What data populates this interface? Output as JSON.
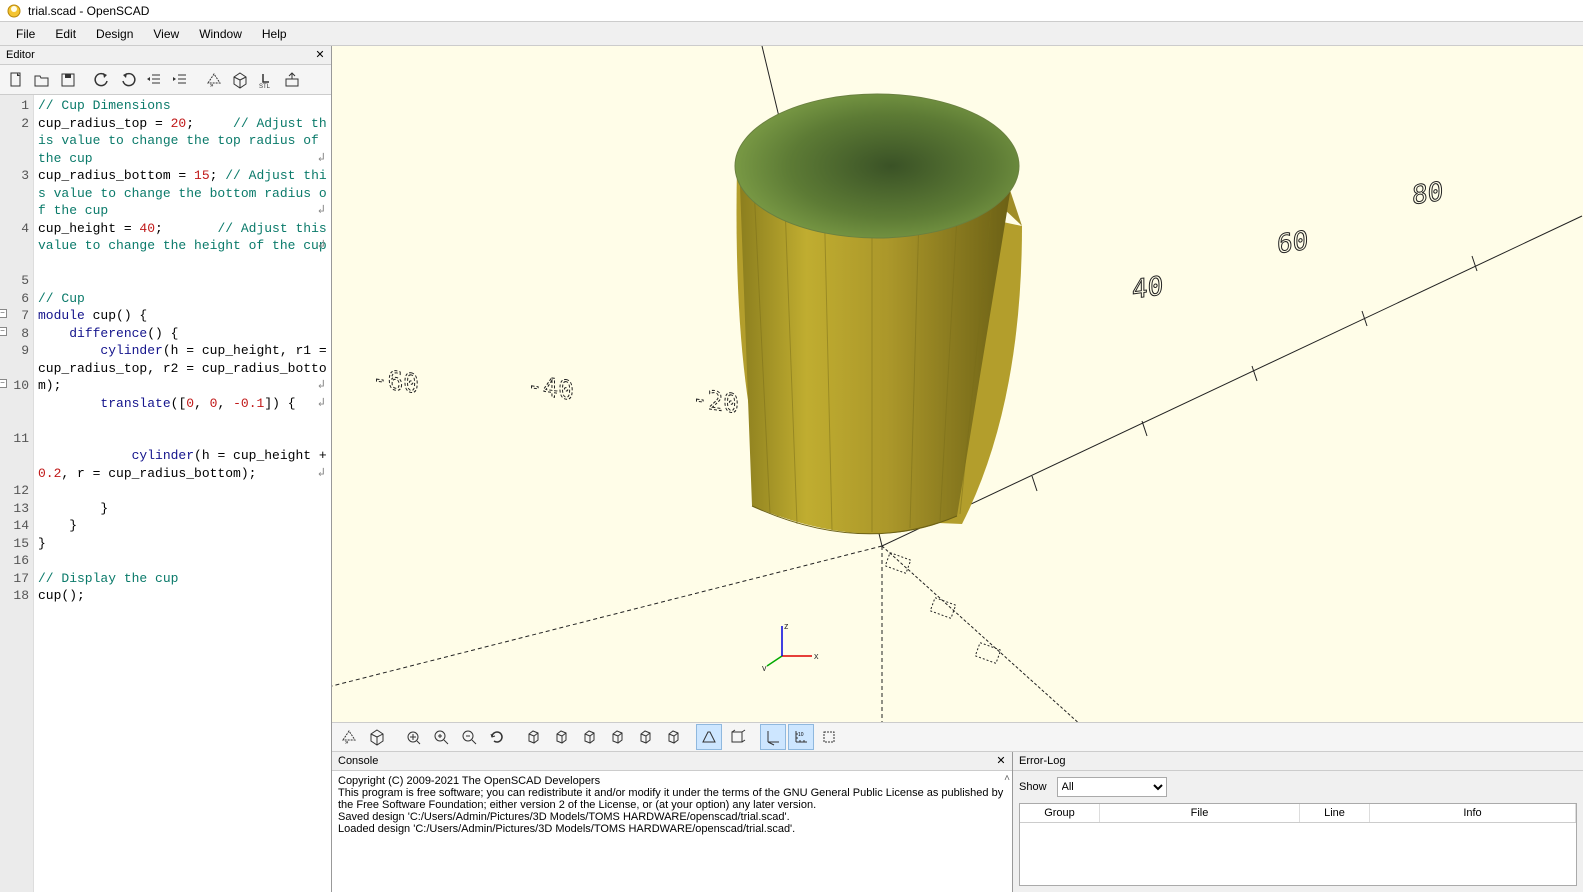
{
  "window": {
    "title": "trial.scad - OpenSCAD"
  },
  "menu": [
    "File",
    "Edit",
    "Design",
    "View",
    "Window",
    "Help"
  ],
  "editor": {
    "panel_title": "Editor",
    "toolbar_icons": [
      "new-icon",
      "open-icon",
      "save-icon",
      "undo-icon",
      "redo-icon",
      "unindent-icon",
      "indent-icon",
      "preview-icon",
      "render-icon",
      "stl-icon",
      "send-icon"
    ],
    "code_lines": [
      {
        "n": 1,
        "wrap": false,
        "html": "<span class='c-comment'>// Cup Dimensions</span>"
      },
      {
        "n": 2,
        "wrap": true,
        "html": "cup_radius_top = <span class='c-num'>20</span>;     <span class='c-comment'>// Adjust this value to change the top radius of the cup</span>"
      },
      {
        "n": 3,
        "wrap": true,
        "html": "cup_radius_bottom = <span class='c-num'>15</span>; <span class='c-comment'>// Adjust this value to change the bottom radius of the cup</span>"
      },
      {
        "n": 4,
        "wrap": true,
        "html": "cup_height = <span class='c-num'>40</span>;       <span class='c-comment'>// Adjust this value to change the height of the cup</span>"
      },
      {
        "n": 5,
        "wrap": false,
        "html": ""
      },
      {
        "n": 6,
        "wrap": false,
        "html": "<span class='c-comment'>// Cup</span>"
      },
      {
        "n": 7,
        "wrap": false,
        "fold": true,
        "html": "<span class='c-keyword'>module</span> cup() {"
      },
      {
        "n": 8,
        "wrap": false,
        "fold": true,
        "html": "    <span class='c-keyword'>difference</span>() {"
      },
      {
        "n": 9,
        "wrap": true,
        "html": "        <span class='c-keyword'>cylinder</span>(h = cup_height, r1 = cup_radius_top, r2 = cup_radius_bottom);"
      },
      {
        "n": 10,
        "wrap": true,
        "fold": true,
        "html": "        <span class='c-keyword'>translate</span>([<span class='c-num'>0</span>, <span class='c-num'>0</span>, <span class='c-num'>-0.1</span>]) {"
      },
      {
        "n": 11,
        "wrap": true,
        "html": "            <span class='c-keyword'>cylinder</span>(h = cup_height + <span class='c-num'>0.2</span>, r = cup_radius_bottom);"
      },
      {
        "n": 12,
        "wrap": false,
        "html": "        }"
      },
      {
        "n": 13,
        "wrap": false,
        "html": "    }"
      },
      {
        "n": 14,
        "wrap": false,
        "html": "}"
      },
      {
        "n": 15,
        "wrap": false,
        "html": ""
      },
      {
        "n": 16,
        "wrap": false,
        "html": "<span class='c-comment'>// Display the cup</span>"
      },
      {
        "n": 17,
        "wrap": false,
        "html": "cup();"
      },
      {
        "n": 18,
        "wrap": false,
        "html": ""
      }
    ]
  },
  "viewport": {
    "axis_ticks_pos": [
      "40",
      "60",
      "80"
    ],
    "axis_ticks_neg": [
      "-20",
      "-40",
      "-60"
    ]
  },
  "view_toolbar": {
    "icons": [
      "preview-icon",
      "render-icon",
      "view-all-icon",
      "zoom-in-icon",
      "zoom-out-icon",
      "reset-view-icon",
      "view-right-icon",
      "view-top-icon",
      "view-bottom-icon",
      "view-left-icon",
      "view-front-icon",
      "view-back-icon",
      "perspective-icon",
      "ortho-icon",
      "axes-icon",
      "scale-marker-icon",
      "crosshair-icon"
    ],
    "active": [
      12,
      14,
      15
    ]
  },
  "console": {
    "panel_title": "Console",
    "lines": [
      "Copyright (C) 2009-2021 The OpenSCAD Developers",
      "This program is free software; you can redistribute it and/or modify it under the terms of the GNU General Public License as published by the Free Software Foundation; either version 2 of the License, or (at your option) any later version.",
      "",
      "Saved design 'C:/Users/Admin/Pictures/3D Models/TOMS HARDWARE/openscad/trial.scad'.",
      "Loaded design 'C:/Users/Admin/Pictures/3D Models/TOMS HARDWARE/openscad/trial.scad'."
    ]
  },
  "errorlog": {
    "panel_title": "Error-Log",
    "show_label": "Show",
    "filter_value": "All",
    "columns": [
      "Group",
      "File",
      "Line",
      "Info"
    ]
  }
}
